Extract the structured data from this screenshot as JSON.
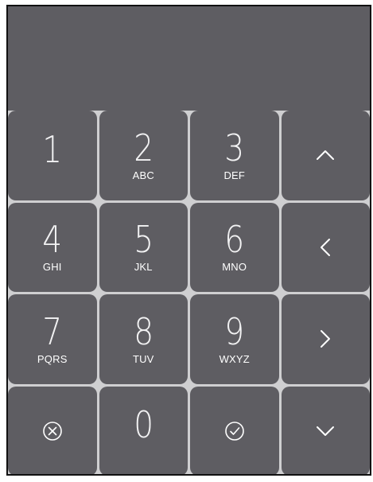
{
  "display": {
    "value": ""
  },
  "keypad": {
    "rows": [
      [
        {
          "digit": "1",
          "letters": ""
        },
        {
          "digit": "2",
          "letters": "ABC"
        },
        {
          "digit": "3",
          "letters": "DEF"
        },
        {
          "icon": "chevron-up-icon"
        }
      ],
      [
        {
          "digit": "4",
          "letters": "GHI"
        },
        {
          "digit": "5",
          "letters": "JKL"
        },
        {
          "digit": "6",
          "letters": "MNO"
        },
        {
          "icon": "chevron-left-icon"
        }
      ],
      [
        {
          "digit": "7",
          "letters": "PQRS"
        },
        {
          "digit": "8",
          "letters": "TUV"
        },
        {
          "digit": "9",
          "letters": "WXYZ"
        },
        {
          "icon": "chevron-right-icon"
        }
      ],
      [
        {
          "icon": "clear-circle-x-icon"
        },
        {
          "digit": "0",
          "letters": ""
        },
        {
          "icon": "confirm-circle-check-icon"
        },
        {
          "icon": "chevron-down-icon"
        }
      ]
    ]
  },
  "colors": {
    "background": "#5e5d62",
    "separator": "#cfcfd1",
    "text": "#ffffff"
  }
}
